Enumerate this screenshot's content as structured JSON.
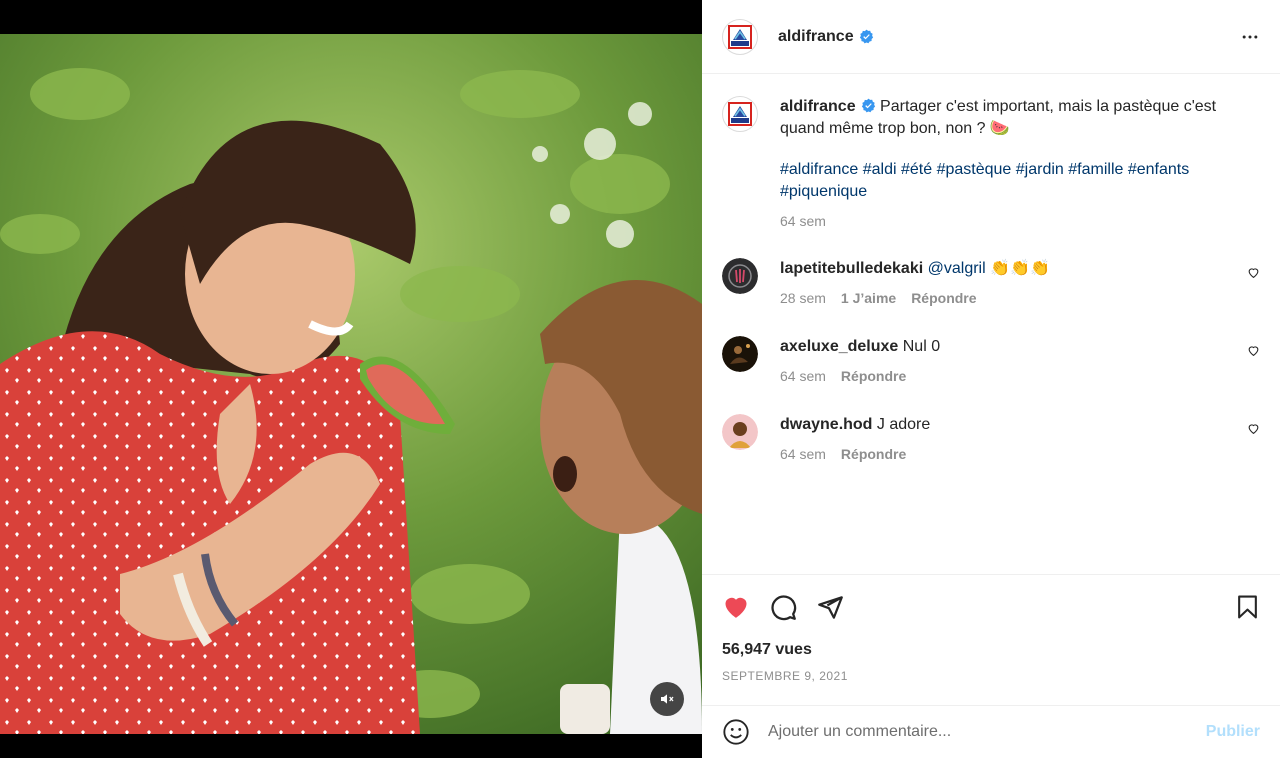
{
  "post": {
    "username": "aldifrance",
    "avatar_logo_text": "ALDI",
    "caption": "Partager c'est important, mais la pastèque c'est quand même trop bon, non ? 🍉",
    "hashtags": [
      "#aldifrance",
      "#aldi",
      "#été",
      "#pastèque",
      "#jardin",
      "#famille",
      "#enfants",
      "#piquenique"
    ],
    "caption_time": "64 sem"
  },
  "comments": [
    {
      "username": "lapetitebulledekaki",
      "mention": "@valgril",
      "text": "👏👏👏",
      "time": "28 sem",
      "likes": "1 J’aime",
      "reply": "Répondre"
    },
    {
      "username": "axeluxe_deluxe",
      "mention": "",
      "text": "Nul 0",
      "time": "64 sem",
      "likes": "",
      "reply": "Répondre"
    },
    {
      "username": "dwayne.hod",
      "mention": "",
      "text": "J adore",
      "time": "64 sem",
      "likes": "",
      "reply": "Répondre"
    }
  ],
  "stats": {
    "views": "56,947 vues",
    "date": "SEPTEMBRE 9, 2021"
  },
  "comment_box": {
    "placeholder": "Ajouter un commentaire...",
    "post_label": "Publier"
  },
  "colors": {
    "like_red": "#ed4956",
    "link_blue": "#00376b",
    "verified_blue": "#3897f0",
    "publish_disabled": "#b2dffc"
  }
}
